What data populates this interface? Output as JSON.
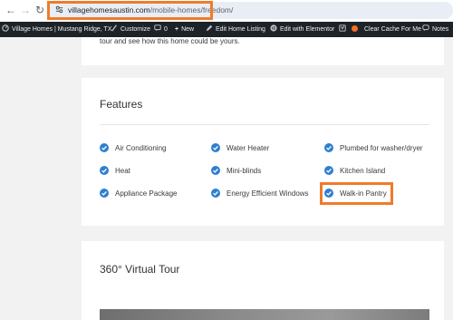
{
  "browser": {
    "back_icon": "arrow-left-icon",
    "forward_icon": "arrow-right-icon",
    "reload_icon": "reload-icon",
    "url_domain": "villagehomesaustin.com",
    "url_path": "/mobile-homes/freedom/"
  },
  "adminbar": {
    "site_name": "Village Homes | Mustang Ridge, TX",
    "customize": "Customize",
    "comments_count": "0",
    "new": "New",
    "edit_listing": "Edit Home Listing",
    "elementor": "Edit with Elementor",
    "clear_cache": "Clear Cache For Me",
    "notes": "Notes"
  },
  "intro": {
    "text": "tour and see how this home could be yours."
  },
  "features": {
    "title": "Features",
    "items": [
      "Air Conditioning",
      "Water Heater",
      "Plumbed for washer/dryer",
      "Heat",
      "Mini-blinds",
      "Kitchen Island",
      "Appliance Package",
      "Energy Efficient Windows",
      "Walk-in Pantry"
    ],
    "check_color": "#2f7fd1",
    "highlight_color": "#f07b2a"
  },
  "tour": {
    "title": "360° Virtual Tour"
  }
}
